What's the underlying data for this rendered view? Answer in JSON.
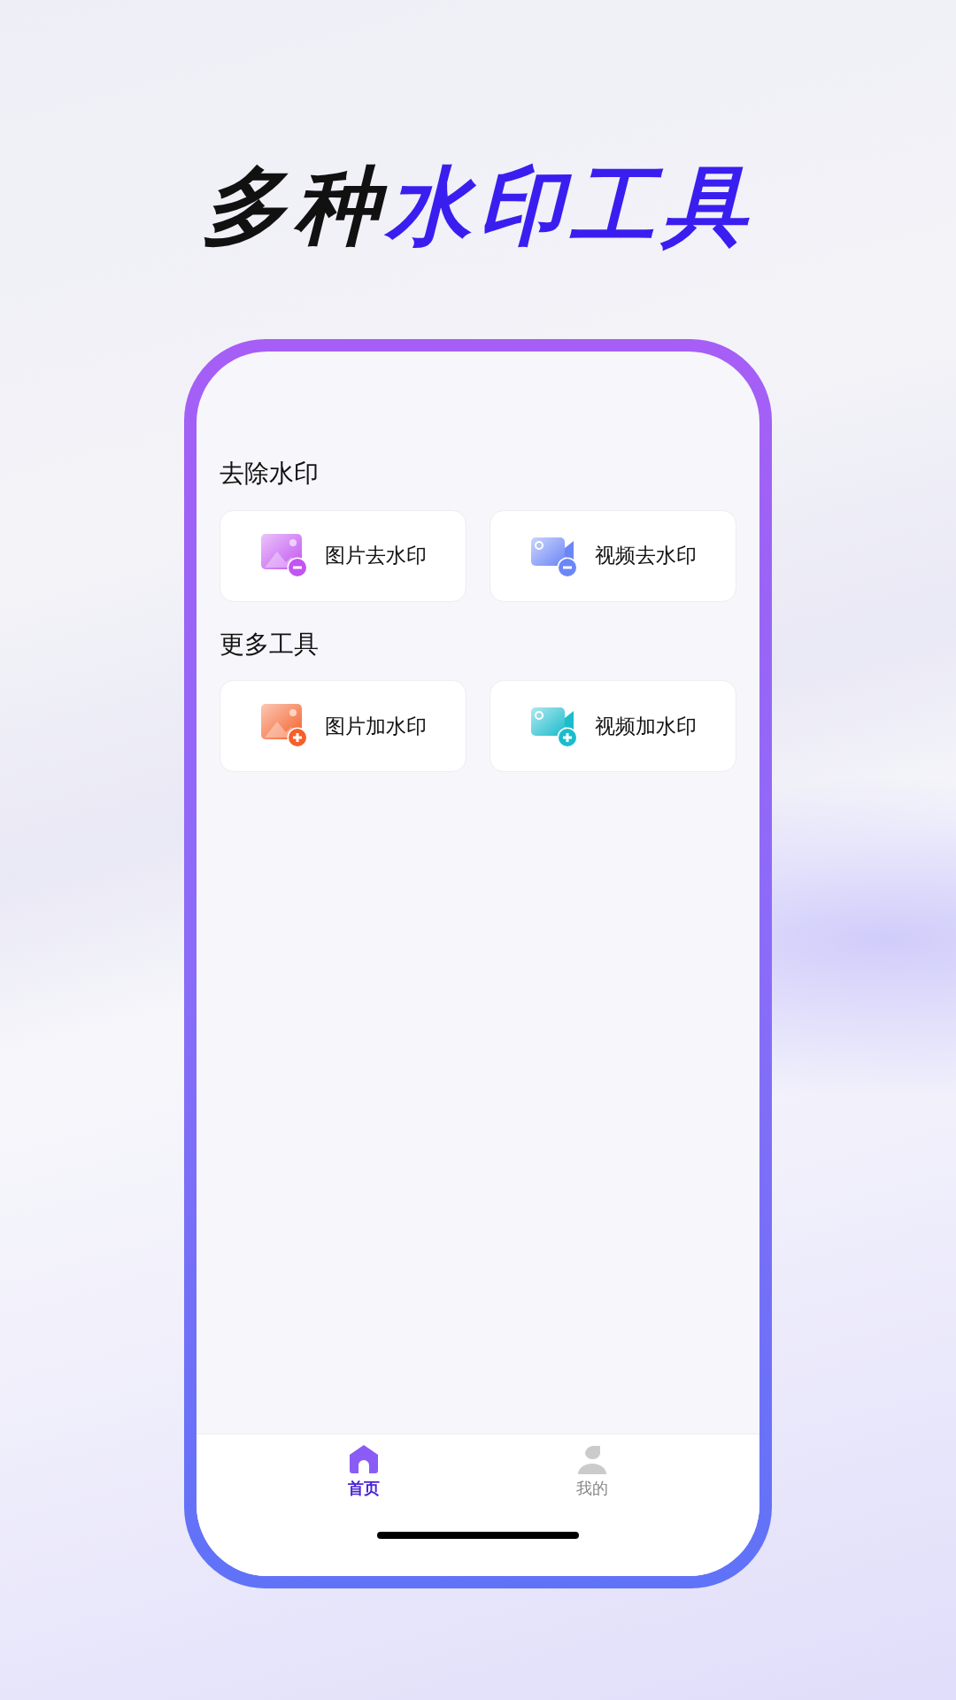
{
  "headline": {
    "text": "多种",
    "accent": "水印工具"
  },
  "sections": [
    {
      "title": "去除水印",
      "tools": [
        {
          "label": "图片去水印",
          "kind": "photo",
          "adds": false,
          "color": "#c254f0"
        },
        {
          "label": "视频去水印",
          "kind": "video",
          "adds": false,
          "color": "#6b86f5"
        }
      ]
    },
    {
      "title": "更多工具",
      "tools": [
        {
          "label": "图片加水印",
          "kind": "photo",
          "adds": true,
          "color": "#f4602a"
        },
        {
          "label": "视频加水印",
          "kind": "video",
          "adds": true,
          "color": "#1bbccc"
        }
      ]
    }
  ],
  "tab_bar": [
    {
      "label": "首页",
      "kind": "home",
      "selected": true
    },
    {
      "label": "我的",
      "kind": "profile",
      "selected": false
    }
  ]
}
